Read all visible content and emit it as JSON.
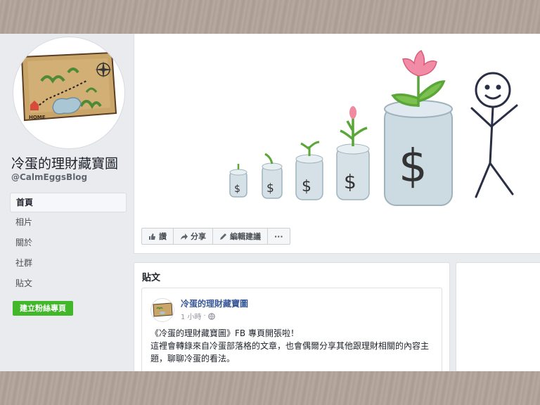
{
  "page": {
    "name": "冷蛋的理財藏寶圖",
    "handle": "@CalmEggsBlog",
    "avatar_map_label": "HOME"
  },
  "nav": {
    "items": [
      {
        "label": "首頁",
        "active": true
      },
      {
        "label": "相片",
        "active": false
      },
      {
        "label": "關於",
        "active": false
      },
      {
        "label": "社群",
        "active": false
      },
      {
        "label": "貼文",
        "active": false
      }
    ]
  },
  "create_button": "建立粉絲專頁",
  "actions": {
    "like": "讚",
    "share": "分享",
    "suggest_edit": "編輯建議",
    "more": "···"
  },
  "posts": {
    "title": "貼文",
    "items": [
      {
        "author": "冷蛋的理財藏寶圖",
        "time": "1 小時",
        "privacy_icon": "globe-icon",
        "text_line1": "《冷蛋的理財藏寶圖》FB 專頁開張啦！",
        "text_line2": "這裡會轉錄來自冷蛋部落格的文章，也會偶爾分享其他跟理財相關的內容主題，聊聊冷蛋的看法。"
      }
    ]
  },
  "colors": {
    "link": "#385898",
    "create_button": "#42b72a",
    "screen_bg": "#e9ebee"
  }
}
